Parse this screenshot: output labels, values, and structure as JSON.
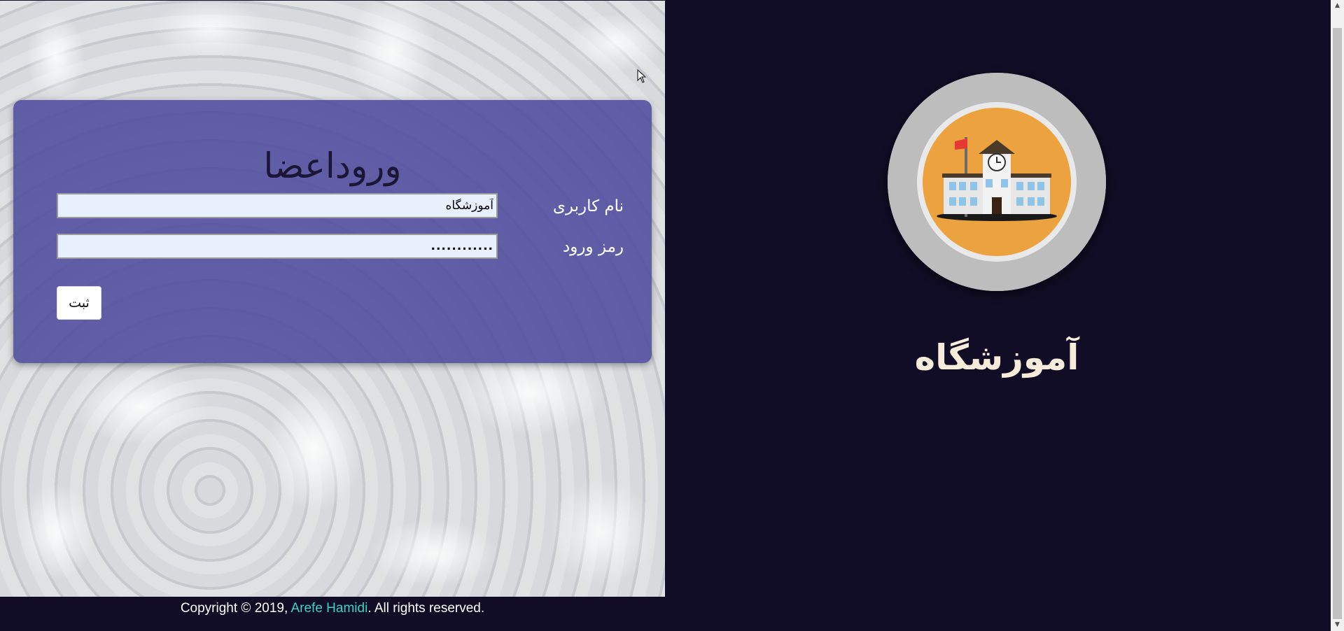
{
  "login": {
    "title": "وروداعضا",
    "username_label": "نام کاربری",
    "username_value": "آموزشگاه",
    "password_label": "رمز ورود",
    "password_value": "............",
    "submit_label": "ثبت"
  },
  "brand": {
    "name": "آموزشگاه",
    "logo_icon": "school-building-icon"
  },
  "footer": {
    "prefix": "Copyright © 2019, ",
    "author": "Arefe Hamidi",
    "suffix": ". All rights reserved."
  },
  "colors": {
    "background": "#110d26",
    "card": "#504a9e",
    "brand_text": "#f6ecd9",
    "footer_link": "#3dd3c2",
    "logo_inner": "#eca33f"
  }
}
